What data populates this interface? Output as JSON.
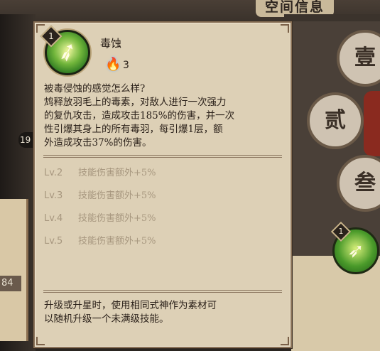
{
  "background": {
    "title": "空间信息",
    "left_number_top": "19",
    "left_number_bottom": "84",
    "tabs": [
      "壹",
      "贰",
      "叁"
    ],
    "small_skill_level": "1"
  },
  "skill": {
    "level_badge": "1",
    "name": "毒蚀",
    "cost_icon": "blue-soulfire-icon",
    "cost": "3",
    "description": [
      "被毒侵蚀的感觉怎么样?",
      "鸩释放羽毛上的毒素，对敌人进行一次强力",
      "的复仇攻击，造成攻击185%的伤害，并一次",
      "性引爆其身上的所有毒羽，每引爆1层，额",
      "外造成攻击37%的伤害。"
    ],
    "levels": [
      {
        "label": "Lv.2",
        "effect": "技能伤害额外+5%"
      },
      {
        "label": "Lv.3",
        "effect": "技能伤害额外+5%"
      },
      {
        "label": "Lv.4",
        "effect": "技能伤害额外+5%"
      },
      {
        "label": "Lv.5",
        "effect": "技能伤害额外+5%"
      }
    ],
    "footer": [
      "升级或升星时，使用相同式神作为素材可",
      "以随机升级一个未满级技能。"
    ]
  },
  "colors": {
    "panel_bg": "#ddd0b6",
    "text_main": "#2b211a",
    "text_locked": "#a7977f",
    "skill_green": "#6fb43a",
    "cost_blue": "#2f7df0"
  }
}
